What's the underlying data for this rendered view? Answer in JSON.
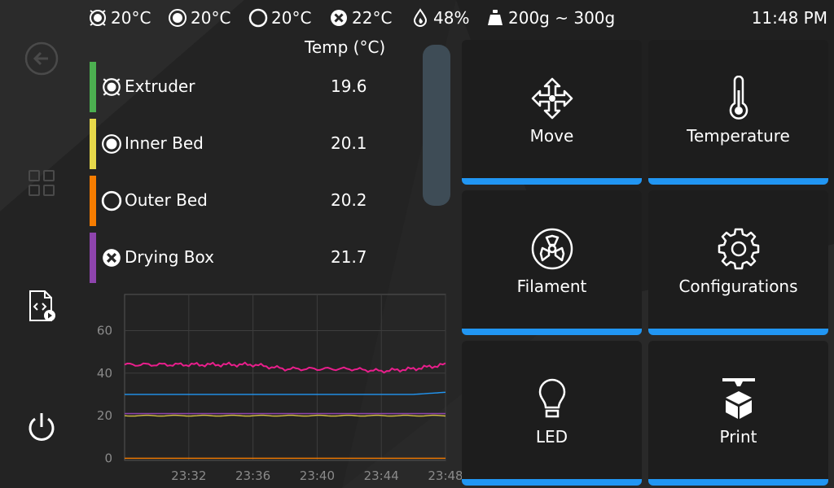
{
  "status": {
    "extruder_temp": "20°C",
    "inner_bed_temp": "20°C",
    "outer_bed_temp": "20°C",
    "drying_box_temp": "22°C",
    "humidity": "48%",
    "filament_weight": "200g ~ 300g",
    "clock": "11:48 PM",
    "icons": [
      "extruder-icon",
      "inner-bed-icon",
      "outer-bed-icon",
      "drying-box-icon",
      "humidity-drop-icon",
      "weight-icon"
    ]
  },
  "nav": {
    "icons": [
      "back-arrow-icon",
      "grid-icon",
      "file-code-icon",
      "power-icon"
    ]
  },
  "temps": {
    "header": "Temp (°C)",
    "rows": [
      {
        "name": "Extruder",
        "value": "19.6",
        "color": "#4caf50",
        "icon": "extruder-icon"
      },
      {
        "name": "Inner Bed",
        "value": "20.1",
        "color": "#e6d84a",
        "icon": "inner-bed-icon"
      },
      {
        "name": "Outer Bed",
        "value": "20.2",
        "color": "#f57c00",
        "icon": "outer-bed-icon"
      },
      {
        "name": "Drying Box",
        "value": "21.7",
        "color": "#8e44ad",
        "icon": "drying-box-icon"
      }
    ]
  },
  "chart_data": {
    "type": "line",
    "x": [
      "23:28",
      "23:30",
      "23:32",
      "23:34",
      "23:36",
      "23:38",
      "23:40",
      "23:42",
      "23:44",
      "23:46",
      "23:48"
    ],
    "xticks": [
      "23:32",
      "23:36",
      "23:40",
      "23:44",
      "23:48"
    ],
    "yticks": [
      "0",
      "20",
      "40",
      "60"
    ],
    "ylim": [
      -1,
      77
    ],
    "grid": true,
    "series": [
      {
        "color": "#e91e8c",
        "values": [
          44,
          44,
          44,
          44,
          44,
          42,
          42,
          42,
          41,
          42,
          44
        ]
      },
      {
        "color": "#2196f3",
        "values": [
          30,
          30,
          30,
          30,
          30,
          30,
          30,
          30,
          30,
          30,
          31
        ]
      },
      {
        "color": "#d4c040",
        "values": [
          20,
          20,
          20,
          20,
          20,
          20,
          20,
          20,
          20,
          20,
          20
        ]
      },
      {
        "color": "#8e44ad",
        "values": [
          21,
          21,
          21,
          21,
          21,
          21,
          21,
          21,
          21,
          21,
          21
        ]
      },
      {
        "color": "#f57c00",
        "values": [
          0,
          0,
          0,
          0,
          0,
          0,
          0,
          0,
          0,
          0,
          0
        ]
      }
    ]
  },
  "tiles": [
    {
      "label": "Move",
      "icon": "move-arrows-icon"
    },
    {
      "label": "Temperature",
      "icon": "thermometer-icon"
    },
    {
      "label": "Filament",
      "icon": "filament-spool-icon"
    },
    {
      "label": "Configurations",
      "icon": "gear-icon"
    },
    {
      "label": "LED",
      "icon": "lightbulb-icon"
    },
    {
      "label": "Print",
      "icon": "printer-icon"
    }
  ],
  "colors": {
    "accent": "#2196f3",
    "tile_bg": "#1d1d1d",
    "page_bg": "#262626"
  }
}
